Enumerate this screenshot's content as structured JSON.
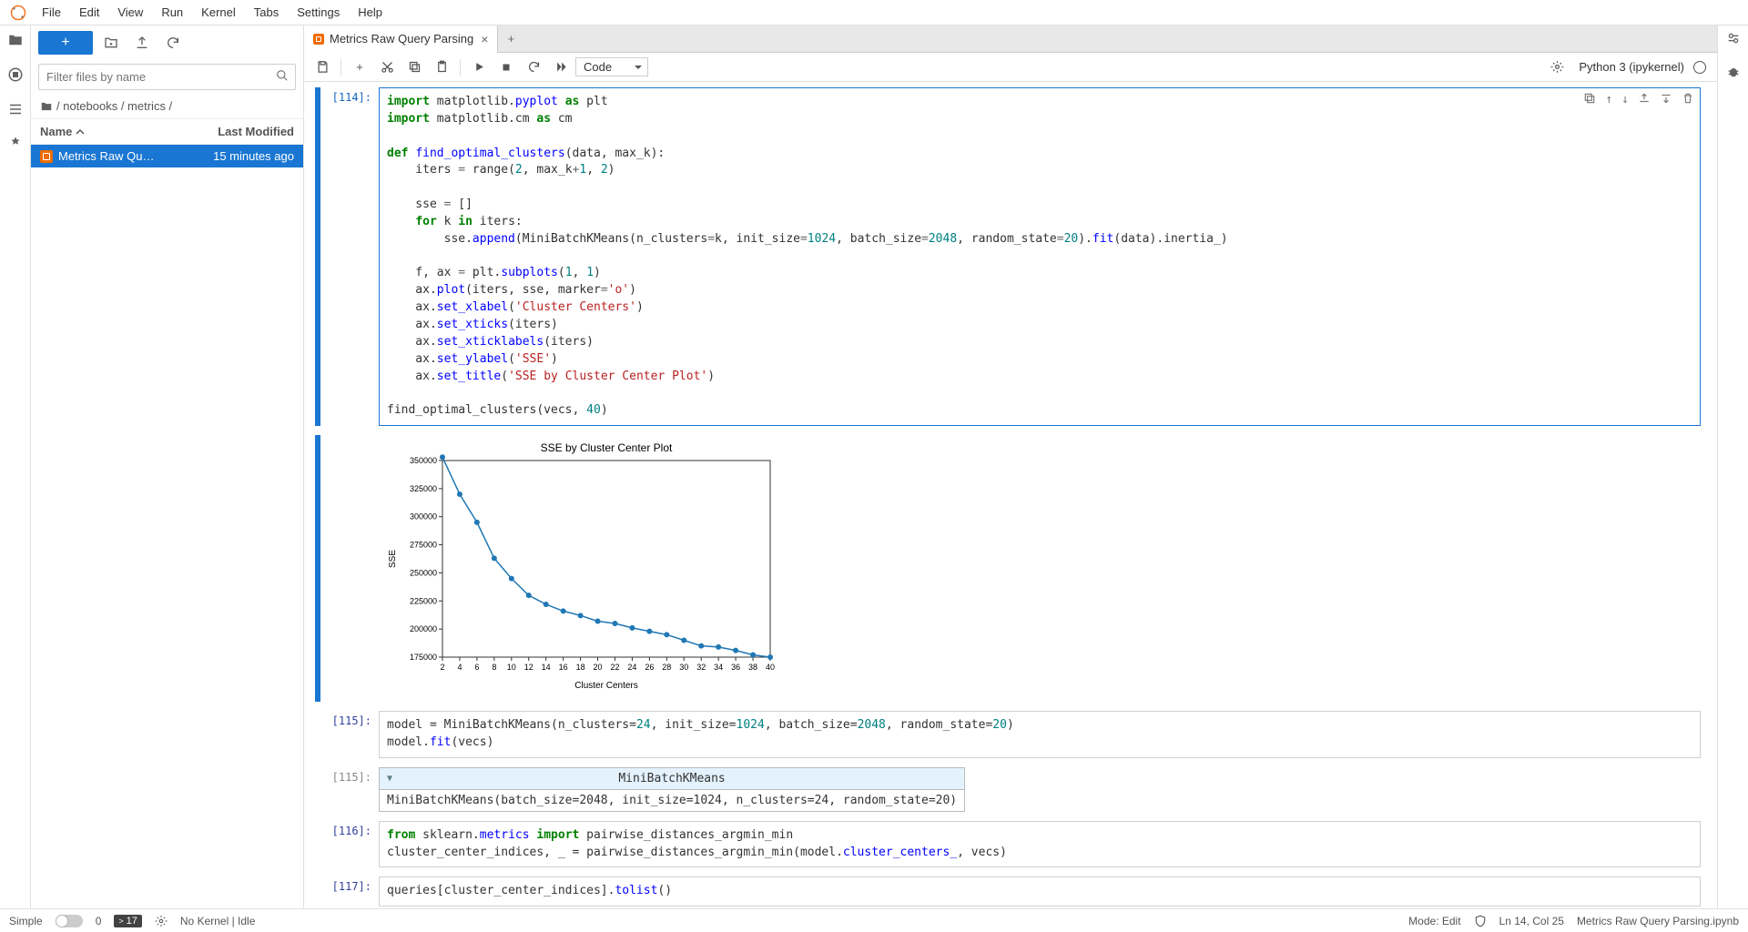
{
  "menu": {
    "items": [
      "File",
      "Edit",
      "View",
      "Run",
      "Kernel",
      "Tabs",
      "Settings",
      "Help"
    ]
  },
  "filebrowser": {
    "filter_placeholder": "Filter files by name",
    "breadcrumb": [
      "/",
      "notebooks",
      "/",
      "metrics",
      "/"
    ],
    "header": {
      "name": "Name",
      "mod": "Last Modified"
    },
    "items": [
      {
        "name": "Metrics Raw Qu…",
        "mod": "15 minutes ago"
      }
    ]
  },
  "tab": {
    "title": "Metrics Raw Query Parsing"
  },
  "toolbar": {
    "celltype": "Code",
    "kernel": "Python 3 (ipykernel)"
  },
  "cells": {
    "c114": {
      "prompt": "[114]:",
      "code_lines": [
        {
          "t": "import",
          "c": "kw"
        },
        {
          "t": " matplotlib."
        },
        {
          "t": "pyplot",
          "c": "fn"
        },
        {
          "t": " "
        },
        {
          "t": "as",
          "c": "kw"
        },
        {
          "t": " plt\n"
        },
        {
          "t": "import",
          "c": "kw"
        },
        {
          "t": " matplotlib.cm "
        },
        {
          "t": "as",
          "c": "kw"
        },
        {
          "t": " cm\n\n"
        },
        {
          "t": "def",
          "c": "kw"
        },
        {
          "t": " "
        },
        {
          "t": "find_optimal_clusters",
          "c": "fn"
        },
        {
          "t": "(data, max_k):\n"
        },
        {
          "t": "    iters "
        },
        {
          "t": "=",
          "c": "op"
        },
        {
          "t": " range("
        },
        {
          "t": "2",
          "c": "num"
        },
        {
          "t": ", max_k"
        },
        {
          "t": "+",
          "c": "op"
        },
        {
          "t": "1",
          "c": "num"
        },
        {
          "t": ", "
        },
        {
          "t": "2",
          "c": "num"
        },
        {
          "t": ")\n\n"
        },
        {
          "t": "    sse "
        },
        {
          "t": "=",
          "c": "op"
        },
        {
          "t": " []\n"
        },
        {
          "t": "    "
        },
        {
          "t": "for",
          "c": "kw"
        },
        {
          "t": " k "
        },
        {
          "t": "in",
          "c": "kw"
        },
        {
          "t": " iters:\n"
        },
        {
          "t": "        sse."
        },
        {
          "t": "append",
          "c": "fn"
        },
        {
          "t": "(MiniBatchKMeans(n_clusters"
        },
        {
          "t": "=",
          "c": "op"
        },
        {
          "t": "k, init_size"
        },
        {
          "t": "=",
          "c": "op"
        },
        {
          "t": "1024",
          "c": "num"
        },
        {
          "t": ", batch_size"
        },
        {
          "t": "=",
          "c": "op"
        },
        {
          "t": "2048",
          "c": "num"
        },
        {
          "t": ", random_state"
        },
        {
          "t": "=",
          "c": "op"
        },
        {
          "t": "20",
          "c": "num"
        },
        {
          "t": ")."
        },
        {
          "t": "fit",
          "c": "fn"
        },
        {
          "t": "(data).inertia_)\n\n"
        },
        {
          "t": "    f, ax "
        },
        {
          "t": "=",
          "c": "op"
        },
        {
          "t": " plt."
        },
        {
          "t": "subplots",
          "c": "fn"
        },
        {
          "t": "("
        },
        {
          "t": "1",
          "c": "num"
        },
        {
          "t": ", "
        },
        {
          "t": "1",
          "c": "num"
        },
        {
          "t": ")\n"
        },
        {
          "t": "    ax."
        },
        {
          "t": "plot",
          "c": "fn"
        },
        {
          "t": "(iters, sse, marker"
        },
        {
          "t": "=",
          "c": "op"
        },
        {
          "t": "'o'",
          "c": "str"
        },
        {
          "t": ")\n"
        },
        {
          "t": "    ax."
        },
        {
          "t": "set_xlabel",
          "c": "fn"
        },
        {
          "t": "("
        },
        {
          "t": "'Cluster Centers'",
          "c": "str"
        },
        {
          "t": ")\n"
        },
        {
          "t": "    ax."
        },
        {
          "t": "set_xticks",
          "c": "fn"
        },
        {
          "t": "(iters)\n"
        },
        {
          "t": "    ax."
        },
        {
          "t": "set_xticklabels",
          "c": "fn"
        },
        {
          "t": "(iters)\n"
        },
        {
          "t": "    ax."
        },
        {
          "t": "set_ylabel",
          "c": "fn"
        },
        {
          "t": "("
        },
        {
          "t": "'SSE'",
          "c": "str"
        },
        {
          "t": ")\n"
        },
        {
          "t": "    ax."
        },
        {
          "t": "set_title",
          "c": "fn"
        },
        {
          "t": "("
        },
        {
          "t": "'SSE by Cluster Center Plot'",
          "c": "str"
        },
        {
          "t": ")\n\n"
        },
        {
          "t": "find_optimal_clusters(vecs, "
        },
        {
          "t": "40",
          "c": "num"
        },
        {
          "t": ")"
        }
      ]
    },
    "c115": {
      "prompt": "[115]:",
      "code_raw": "model = MiniBatchKMeans(n_clusters=24, init_size=1024, batch_size=2048, random_state=20)\nmodel.fit(vecs)"
    },
    "c115out": {
      "prompt": "[115]:",
      "head": "MiniBatchKMeans",
      "body": "MiniBatchKMeans(batch_size=2048, init_size=1024, n_clusters=24, random_state=20)"
    },
    "c116": {
      "prompt": "[116]:",
      "code_raw": "from sklearn.metrics import pairwise_distances_argmin_min\ncluster_center_indices, _ = pairwise_distances_argmin_min(model.cluster_centers_, vecs)"
    },
    "c117": {
      "prompt": "[117]:",
      "code_raw": "queries[cluster_center_indices].tolist()"
    }
  },
  "chart_data": {
    "type": "line",
    "title": "SSE by Cluster Center Plot",
    "xlabel": "Cluster Centers",
    "ylabel": "SSE",
    "x": [
      2,
      4,
      6,
      8,
      10,
      12,
      14,
      16,
      18,
      20,
      22,
      24,
      26,
      28,
      30,
      32,
      34,
      36,
      38,
      40
    ],
    "y": [
      353000,
      320000,
      295000,
      263000,
      245000,
      230000,
      222000,
      216000,
      212000,
      207000,
      205000,
      201000,
      198000,
      195000,
      190000,
      185000,
      184000,
      181000,
      177000,
      175000
    ],
    "xlim": [
      2,
      40
    ],
    "ylim": [
      175000,
      350000
    ],
    "yticks": [
      175000,
      200000,
      225000,
      250000,
      275000,
      300000,
      325000,
      350000
    ]
  },
  "status": {
    "simple": "Simple",
    "zero": "0",
    "term": "17",
    "kernel": "No Kernel | Idle",
    "mode": "Mode: Edit",
    "pos": "Ln 14, Col 25",
    "file": "Metrics Raw Query Parsing.ipynb"
  }
}
